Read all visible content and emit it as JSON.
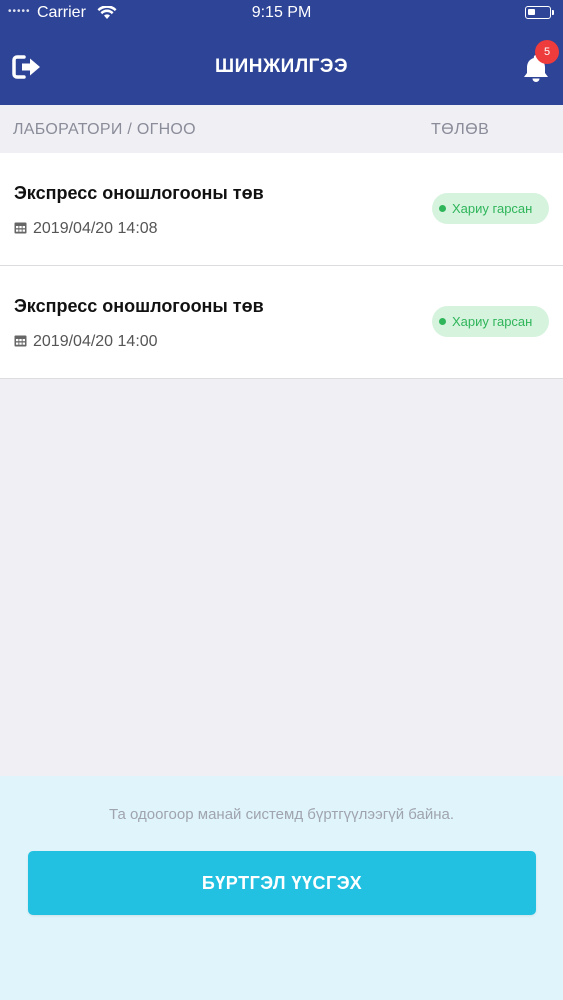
{
  "status_bar": {
    "signal": "•••••",
    "carrier": "Carrier",
    "time": "9:15 PM"
  },
  "header": {
    "title": "ШИНЖИЛГЭЭ",
    "notification_count": "5",
    "logout_icon": "sign-out-icon",
    "bell_icon": "bell-icon",
    "color": "#2e4497"
  },
  "columns": {
    "left": "ЛАБОРАТОРИ / ОГНОО",
    "right": "ТӨЛӨВ"
  },
  "items": [
    {
      "name": "Экспресс оношлогооны төв",
      "date": "2019/04/20 14:08",
      "status": "Хариу гарсан"
    },
    {
      "name": "Экспресс оношлогооны төв",
      "date": "2019/04/20 14:00",
      "status": "Хариу гарсан"
    }
  ],
  "footer": {
    "message": "Та одоогоор манай системд бүртгүүлээгүй байна.",
    "button_label": "БҮРТГЭЛ ҮҮСГЭХ",
    "button_color": "#22c1e2"
  },
  "status_color": "#2fb55a"
}
